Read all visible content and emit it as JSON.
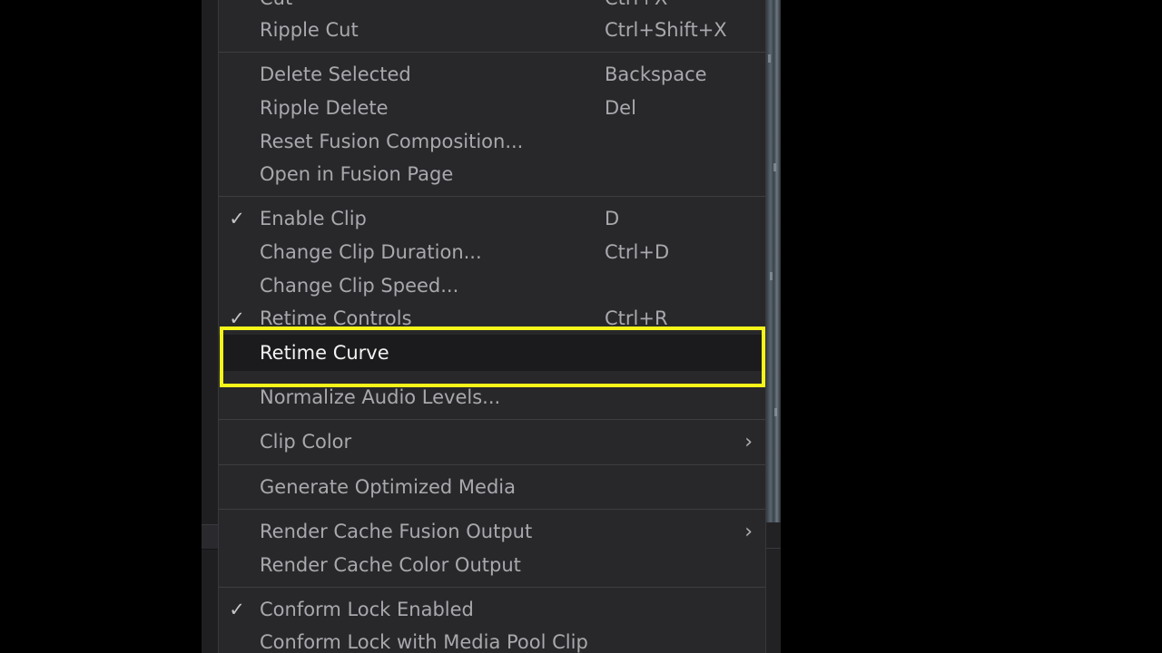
{
  "menu": {
    "items": [
      {
        "label": "Cut",
        "shortcut": "Ctrl+X",
        "checked": false,
        "submenu": false
      },
      {
        "label": "Ripple Cut",
        "shortcut": "Ctrl+Shift+X",
        "checked": false,
        "submenu": false
      },
      {
        "label": "Delete Selected",
        "shortcut": "Backspace",
        "checked": false,
        "submenu": false
      },
      {
        "label": "Ripple Delete",
        "shortcut": "Del",
        "checked": false,
        "submenu": false
      },
      {
        "label": "Reset Fusion Composition...",
        "shortcut": "",
        "checked": false,
        "submenu": false
      },
      {
        "label": "Open in Fusion Page",
        "shortcut": "",
        "checked": false,
        "submenu": false
      },
      {
        "label": "Enable Clip",
        "shortcut": "D",
        "checked": true,
        "submenu": false
      },
      {
        "label": "Change Clip Duration...",
        "shortcut": "Ctrl+D",
        "checked": false,
        "submenu": false
      },
      {
        "label": "Change Clip Speed...",
        "shortcut": "",
        "checked": false,
        "submenu": false
      },
      {
        "label": "Retime Controls",
        "shortcut": "Ctrl+R",
        "checked": true,
        "submenu": false
      },
      {
        "label": "Retime Curve",
        "shortcut": "",
        "checked": false,
        "submenu": false,
        "highlighted": true
      },
      {
        "label": "Normalize Audio Levels...",
        "shortcut": "",
        "checked": false,
        "submenu": false
      },
      {
        "label": "Clip Color",
        "shortcut": "",
        "checked": false,
        "submenu": true
      },
      {
        "label": "Generate Optimized Media",
        "shortcut": "",
        "checked": false,
        "submenu": false
      },
      {
        "label": "Render Cache Fusion Output",
        "shortcut": "",
        "checked": false,
        "submenu": true
      },
      {
        "label": "Render Cache Color Output",
        "shortcut": "",
        "checked": false,
        "submenu": false
      },
      {
        "label": "Conform Lock Enabled",
        "shortcut": "",
        "checked": true,
        "submenu": false
      },
      {
        "label": "Conform Lock with Media Pool Clip",
        "shortcut": "",
        "checked": false,
        "submenu": false
      }
    ],
    "check_glyph": "✓",
    "chevron_glyph": "›"
  },
  "colors": {
    "menu_bg": "#28282b",
    "menu_text": "#a9a9ad",
    "highlight_text": "#f2f2f2",
    "highlight_bg": "#1b1b1d",
    "annotation_border": "#f5f51a",
    "page_bg": "#000000"
  },
  "icons": {
    "check": "checkmark-icon",
    "submenu": "chevron-right-icon"
  }
}
